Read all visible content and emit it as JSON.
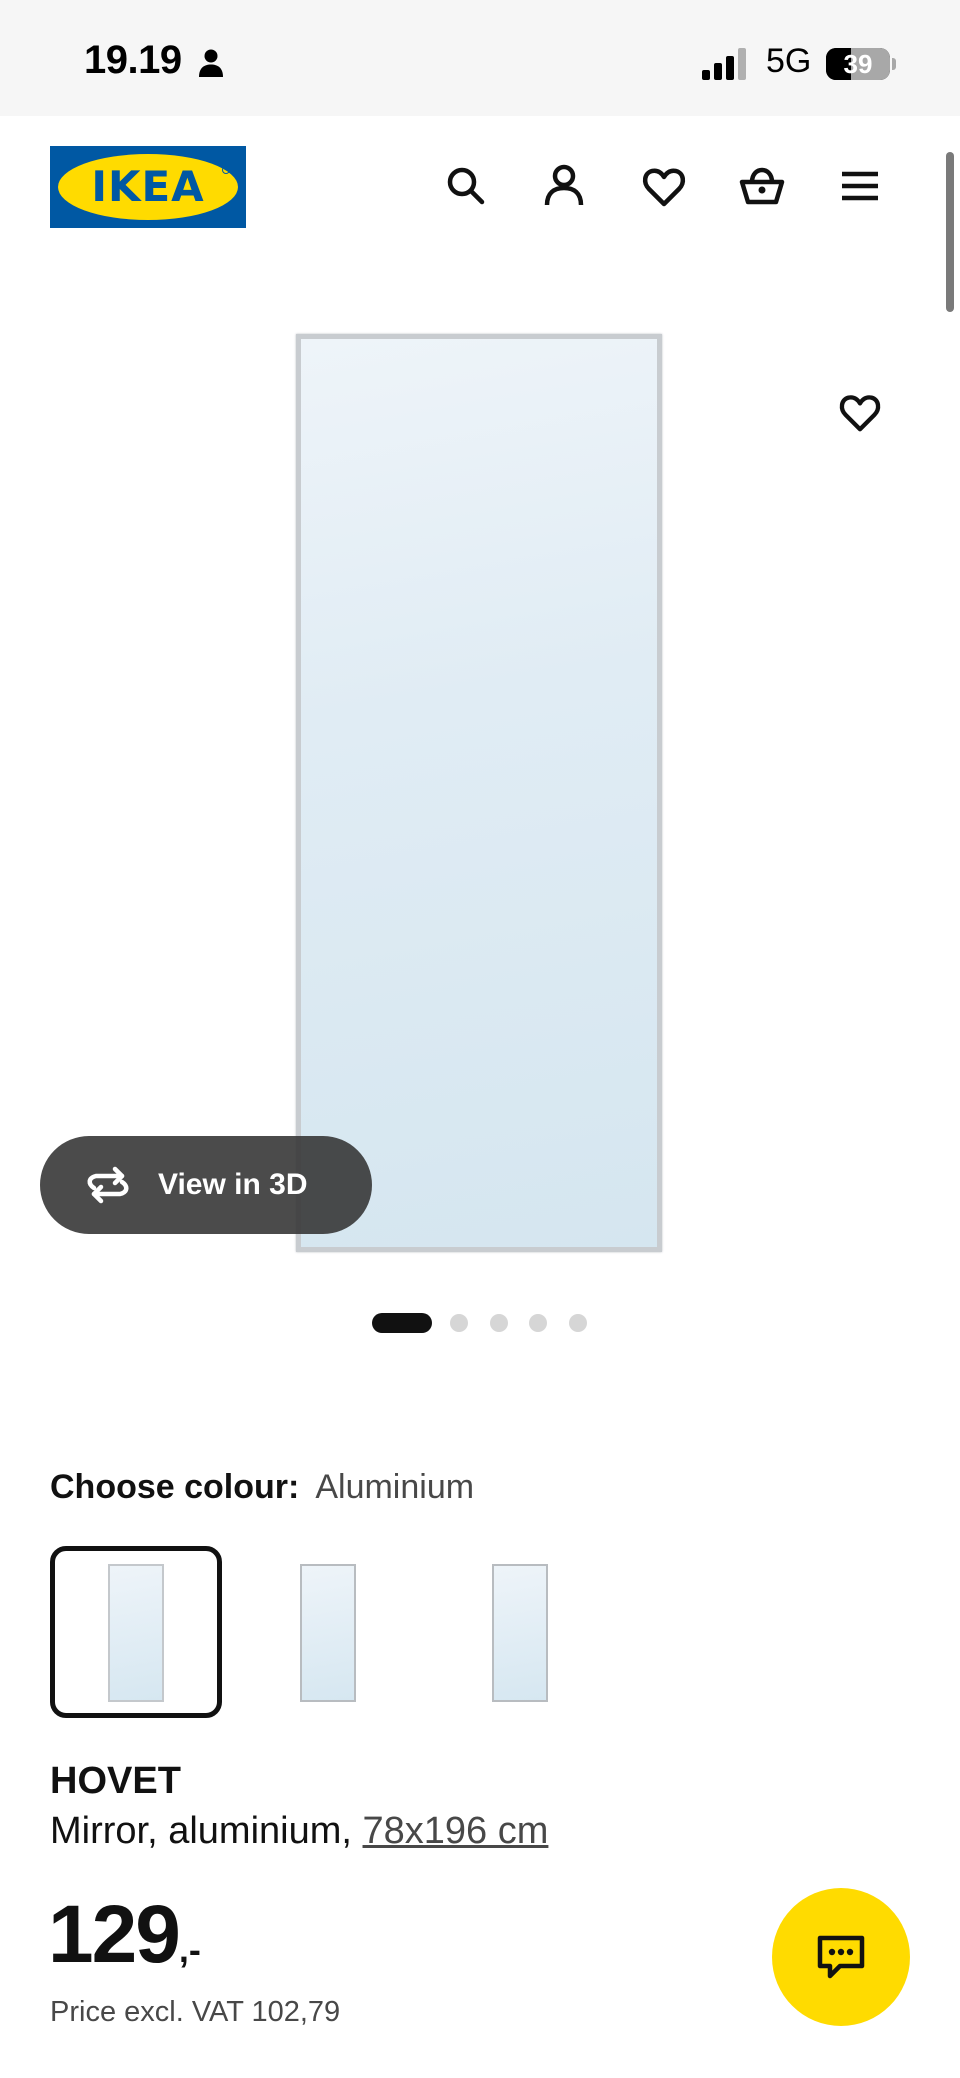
{
  "status_bar": {
    "time": "19.19",
    "network": "5G",
    "battery": "39",
    "battery_level": 0.39
  },
  "header": {
    "logo_text": "IKEA",
    "icons": [
      "search-icon",
      "account-icon",
      "heart-icon",
      "basket-icon",
      "menu-icon"
    ]
  },
  "gallery": {
    "view_3d_label": "View in 3D",
    "image_count": 5,
    "active_index": 0
  },
  "colour": {
    "label": "Choose colour:",
    "selected": "Aluminium",
    "options_count": 3
  },
  "product": {
    "name": "HOVET",
    "description": "Mirror, aluminium,",
    "size": "78x196 cm",
    "price": "129",
    "price_suffix": ",-",
    "price_excl_vat": "Price excl. VAT 102,79"
  },
  "colors": {
    "brand_blue": "#0058a3",
    "brand_yellow": "#ffdb00"
  }
}
